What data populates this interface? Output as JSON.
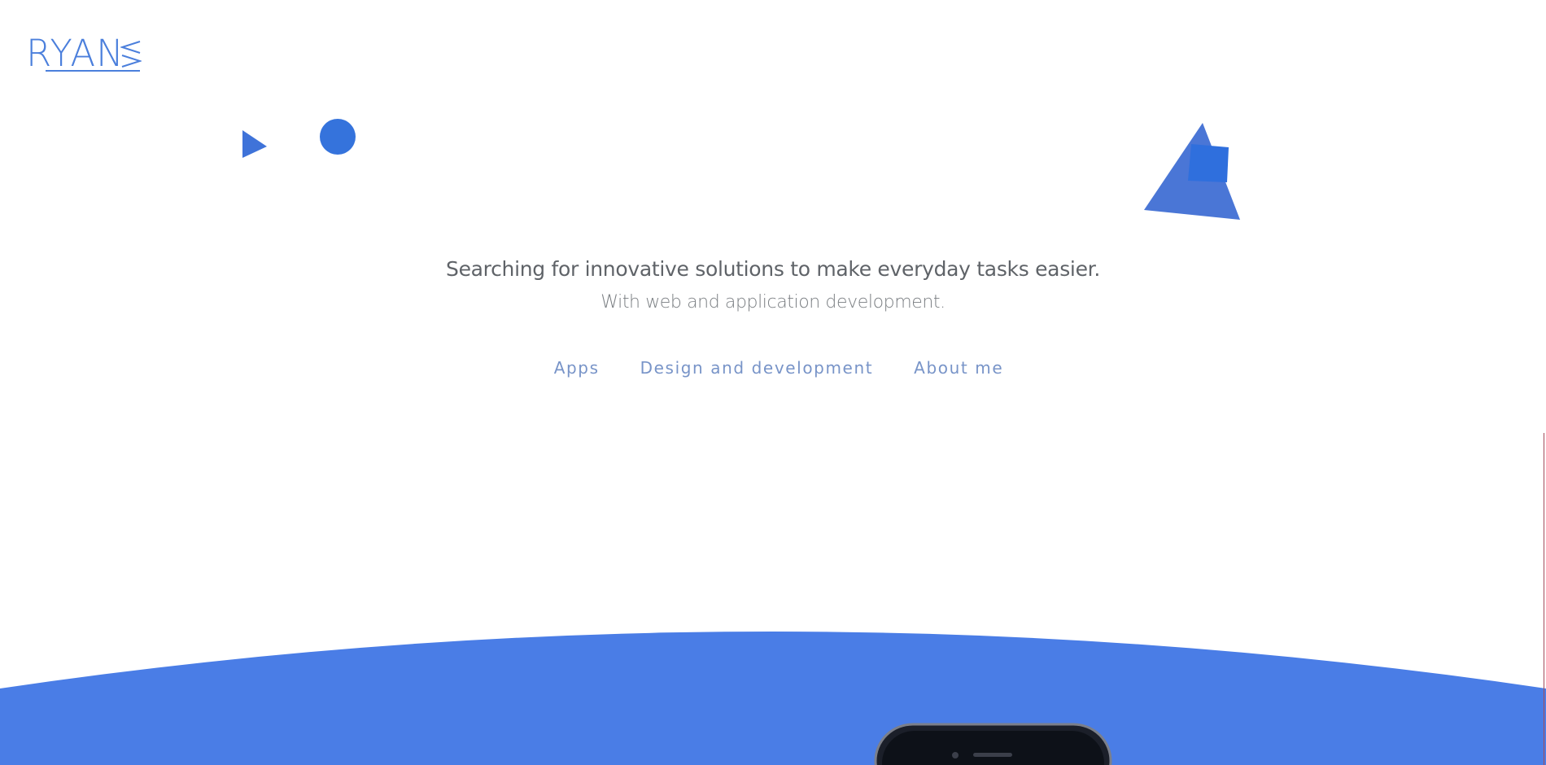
{
  "logo": {
    "text": "RYAN",
    "color": "#4b7fdc"
  },
  "hero": {
    "headline": "Searching for innovative solutions to make everyday tasks easier.",
    "subheadline": "With web and application development."
  },
  "nav": {
    "items": [
      {
        "label": "Apps"
      },
      {
        "label": "Design and development"
      },
      {
        "label": "About me"
      }
    ],
    "link_color": "#7894c8"
  },
  "colors": {
    "accent": "#4a7de6",
    "shape_blue": "#3a6fd6",
    "text_dark": "#5f6368",
    "text_muted": "#7a7e82",
    "phone_frame": "#1b1f29"
  },
  "icons": {
    "small_triangle": "triangle-shape",
    "circle": "circle-shape",
    "large_triangle": "triangle-shape",
    "square": "square-shape",
    "phone": "phone-mockup"
  }
}
